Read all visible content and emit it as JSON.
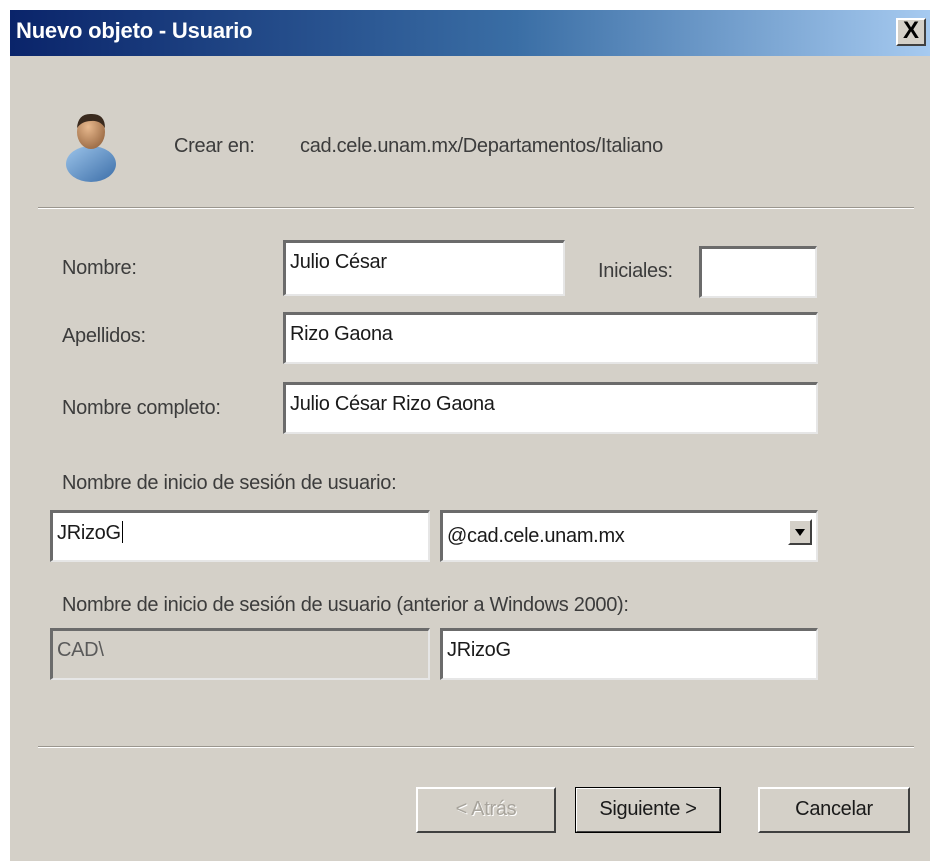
{
  "window": {
    "title": "Nuevo objeto - Usuario",
    "close_label": "X"
  },
  "header": {
    "create_in_label": "Crear en:",
    "create_in_path": "cad.cele.unam.mx/Departamentos/Italiano"
  },
  "form": {
    "first_name": {
      "label": "Nombre:",
      "value": "Julio César"
    },
    "initials": {
      "label": "Iniciales:",
      "value": ""
    },
    "last_name": {
      "label": "Apellidos:",
      "value": "Rizo Gaona"
    },
    "full_name": {
      "label": "Nombre completo:",
      "value": "Julio César Rizo Gaona"
    },
    "logon_name": {
      "label": "Nombre de inicio de sesión de usuario:",
      "value": "JRizoG",
      "domain_selected": "@cad.cele.unam.mx"
    },
    "pre2000_logon": {
      "label": "Nombre de inicio de sesión de usuario (anterior a Windows 2000):",
      "domain_prefix": "CAD\\",
      "value": "JRizoG"
    }
  },
  "buttons": {
    "back": "< Atrás",
    "next": "Siguiente >",
    "cancel": "Cancelar"
  },
  "icons": [
    "user-icon",
    "close-icon",
    "chevron-down-icon"
  ],
  "colors": {
    "titlebar_start": "#0a246a",
    "titlebar_end": "#a6caf0",
    "dialog_bg": "#d4d0c8"
  }
}
